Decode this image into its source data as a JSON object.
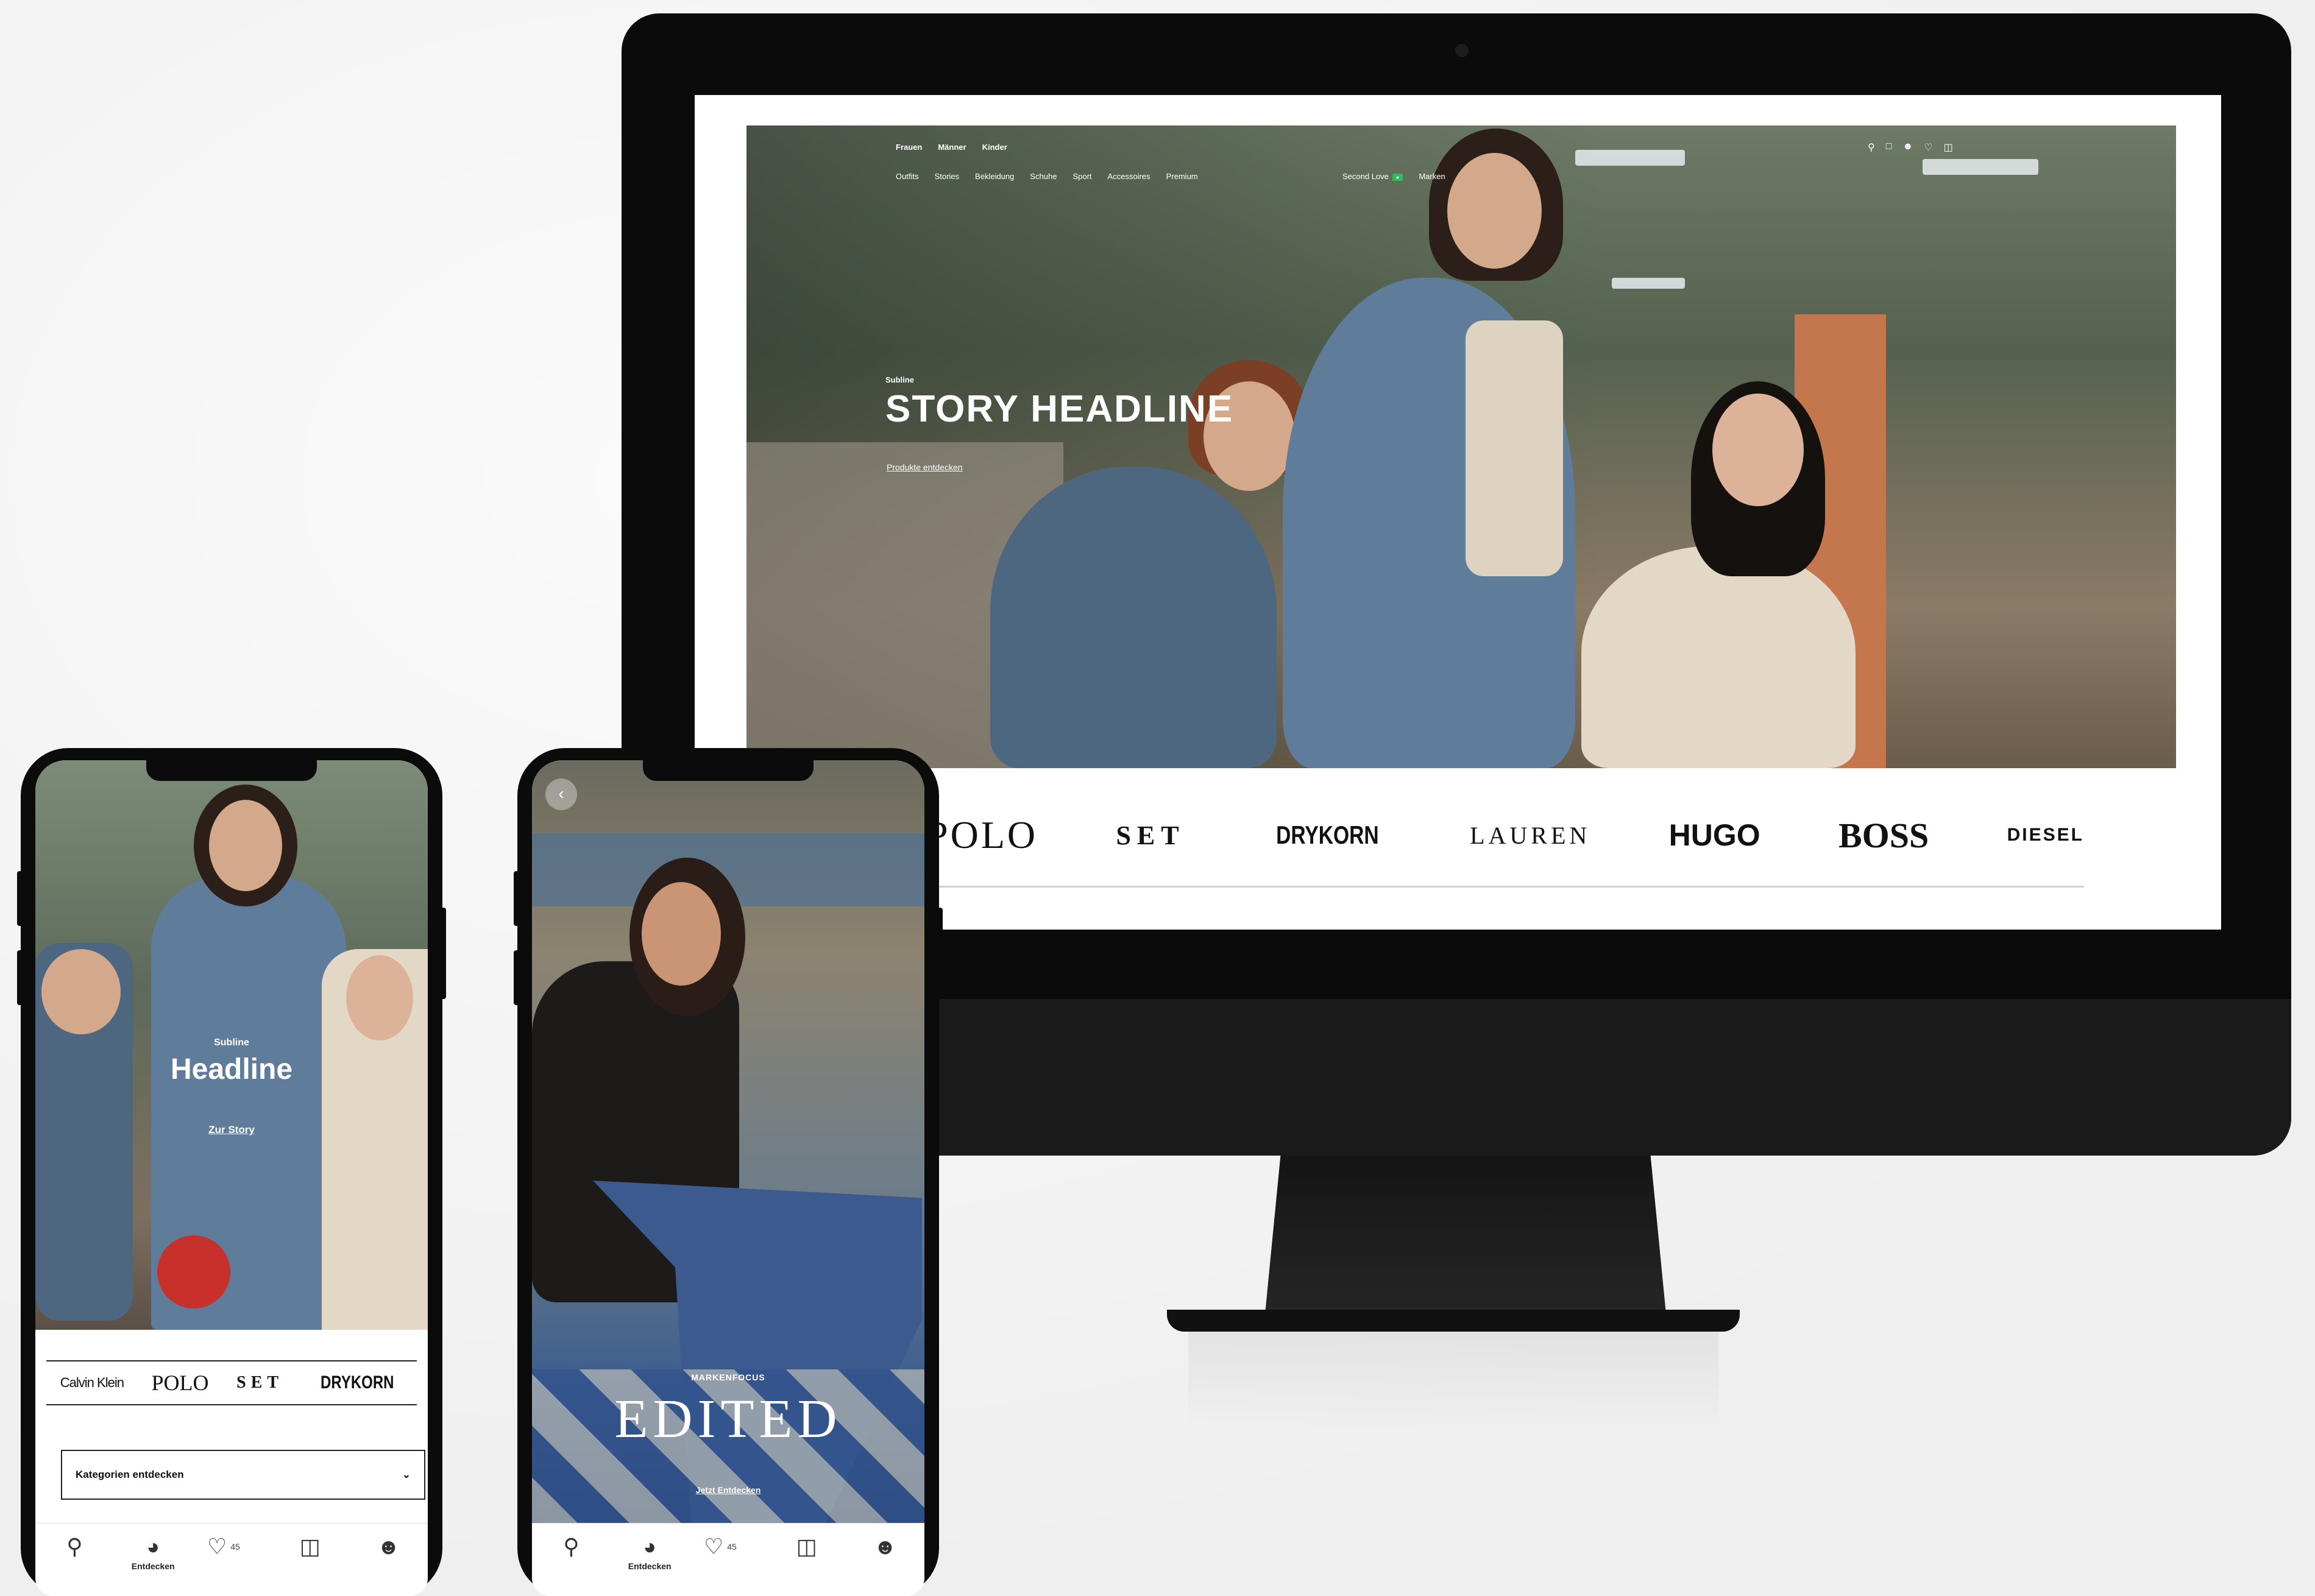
{
  "desktop": {
    "top_nav": [
      "Frauen",
      "Männer",
      "Kinder"
    ],
    "main_nav": [
      "Outfits",
      "Stories",
      "Bekleidung",
      "Schuhe",
      "Sport",
      "Accessoires",
      "Premium"
    ],
    "second_love": "Second Love",
    "marken": "Marken",
    "hero": {
      "subline": "Subline",
      "headline": "STORY HEADLINE",
      "link": "Produkte entdecken"
    },
    "brands": [
      "POLO",
      "SET",
      "DRYKORN",
      "LAUREN",
      "HUGO",
      "BOSS",
      "DIESEL"
    ]
  },
  "phone1": {
    "subline": "Subline",
    "headline": "Headline",
    "link": "Zur Story",
    "brands": [
      "Calvin Klein",
      "POLO",
      "SET",
      "DRYKORN"
    ],
    "dropdown": "Kategorien entdecken",
    "tabs": {
      "active_label": "Entdecken",
      "fav_count": "45"
    }
  },
  "phone2": {
    "kicker": "MARKENFOCUS",
    "headline": "EDITED",
    "link": "Jetzt Entdecken",
    "tabs": {
      "active_label": "Entdecken",
      "fav_count": "45"
    }
  }
}
